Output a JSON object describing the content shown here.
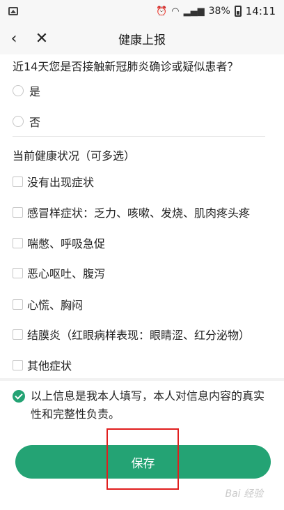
{
  "status_bar": {
    "battery": "38%",
    "time": "14:11"
  },
  "nav": {
    "title": "健康上报"
  },
  "question1": {
    "title": "近14天您是否接触新冠肺炎确诊或疑似患者？",
    "options": [
      "是",
      "否"
    ]
  },
  "question2": {
    "title": "当前健康状况（可多选）",
    "options": [
      "没有出现症状",
      "感冒样症状：乏力、咳嗽、发烧、肌肉疼头疼",
      "喘憋、呼吸急促",
      "恶心呕吐、腹泻",
      "心慌、胸闷",
      "结膜炎（红眼病样表现：眼睛涩、红分泌物）",
      "其他症状"
    ]
  },
  "confirm": {
    "line1": "以上信息是我本人填写，本人对信息内容的真实",
    "line2": "性和完整性负责。",
    "checked": true
  },
  "save_button": {
    "label": "保存"
  },
  "colors": {
    "accent": "#24a374",
    "highlight": "#e01e1e"
  }
}
